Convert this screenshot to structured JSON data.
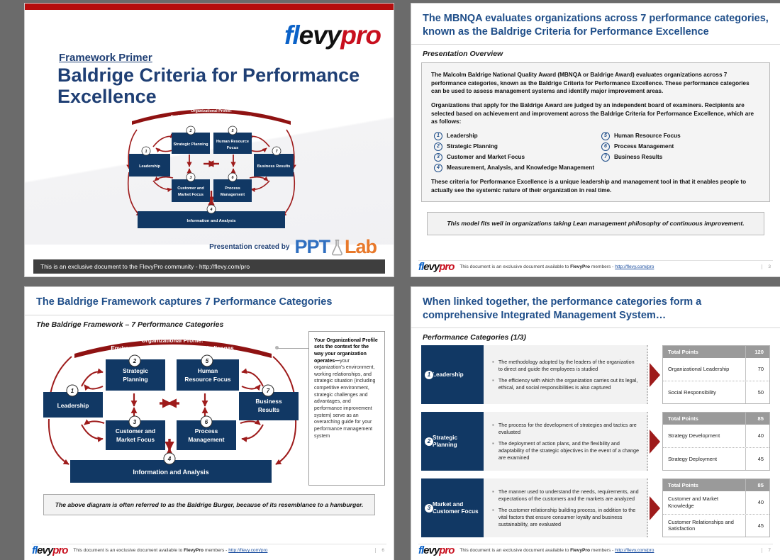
{
  "brand": {
    "logo_part1": "fl",
    "logo_part2": "evy",
    "logo_part3": "pro",
    "accent_blue": "#1f4e89",
    "accent_red": "#b50d0d",
    "dark_navy": "#113864"
  },
  "slide1": {
    "eyebrow": "Framework Primer",
    "title": "Baldrige Criteria for Performance Excellence",
    "created_by_label": "Presentation created by",
    "pptlab_ppt": "PPT",
    "pptlab_lab": "Lab",
    "footer": "This is an exclusive document to the FlevyPro community - http://flevy.com/pro"
  },
  "diagram": {
    "banner_line1": "Organizational Profile:",
    "banner_line2": "Environment, Relationships, and Challenges",
    "boxes": [
      {
        "num": "1",
        "label": "Leadership"
      },
      {
        "num": "2",
        "label": "Strategic Planning"
      },
      {
        "num": "3",
        "label": "Customer and Market Focus"
      },
      {
        "num": "4",
        "label": "Information and Analysis"
      },
      {
        "num": "5",
        "label": "Human Resource Focus"
      },
      {
        "num": "6",
        "label": "Process Management"
      },
      {
        "num": "7",
        "label": "Business Results"
      }
    ]
  },
  "slide2": {
    "title": "The MBNQA evaluates organizations across 7 performance categories, known as the Baldrige Criteria for Performance Excellence",
    "subtitle": "Presentation Overview",
    "para1": "The Malcolm Baldrige National Quality Award (MBNQA or Baldrige Award) evaluates organizations across 7 performance categories, known as the Baldrige Criteria for Performance Excellence. These performance categories can be used to assess management systems and identify major improvement areas.",
    "para2": "Organizations that apply for the Baldrige Award are judged by an independent board of examiners. Recipients are selected based on achievement and improvement across the Baldrige Criteria for Performance Excellence, which are as follows:",
    "criteria": [
      {
        "num": "1",
        "label": "Leadership"
      },
      {
        "num": "5",
        "label": "Human Resource Focus"
      },
      {
        "num": "2",
        "label": "Strategic Planning"
      },
      {
        "num": "6",
        "label": "Process Management"
      },
      {
        "num": "3",
        "label": "Customer and Market Focus"
      },
      {
        "num": "7",
        "label": "Business Results"
      },
      {
        "num": "4",
        "label": "Measurement, Analysis, and Knowledge Management"
      }
    ],
    "closing": "These criteria for Performance Excellence is a unique leadership and management tool in that it enables people to actually see the systemic nature of their organization in real time.",
    "callout": "This model fits well in organizations taking Lean management philosophy of continuous improvement.",
    "page": "3"
  },
  "slide3": {
    "title": "The Baldrige Framework captures 7 Performance Categories",
    "subtitle": "The Baldrige Framework  –  7 Performance Categories",
    "sidebox_bold": "Your Organizational Profile sets the context for the way your organization operates—",
    "sidebox_rest": "your organization's environment, working relationships, and strategic situation (including competitive environment, strategic challenges and advantages, and performance improvement system) serve as an overarching guide for your performance management system",
    "callout": "The above diagram is often referred to as the Baldrige Burger, because of its resemblance to a hamburger.",
    "page": "6"
  },
  "slide4": {
    "title": "When linked together, the performance categories form a comprehensive Integrated Management System…",
    "subtitle": "Performance Categories (1/3)",
    "total_points_label": "Total Points",
    "categories": [
      {
        "num": "1",
        "name": "Leadership",
        "bullets": [
          "The methodology adopted by the leaders of the organization to direct and guide the employees is studied",
          "The efficiency with which the organization carries out its legal, ethical, and social responsibilities is also captured"
        ],
        "total_points": "120",
        "rows": [
          {
            "label": "Organizational Leadership",
            "points": "70"
          },
          {
            "label": "Social Responsibility",
            "points": "50"
          }
        ]
      },
      {
        "num": "2",
        "name": "Strategic Planning",
        "bullets": [
          "The process for the development of strategies and tactics are evaluated",
          "The deployment of action plans, and the flexibility and adaptability of the strategic objectives in the event of a change are examined"
        ],
        "total_points": "85",
        "rows": [
          {
            "label": "Strategy Development",
            "points": "40"
          },
          {
            "label": "Strategy Deployment",
            "points": "45"
          }
        ]
      },
      {
        "num": "3",
        "name": "Market and Customer Focus",
        "bullets": [
          "The manner used to understand the needs, requirements, and expectations of the customers and the markets are analyzed",
          "The customer relationship building process, in addition to the vital factors that ensure consumer loyalty and business sustainability, are evaluated"
        ],
        "total_points": "85",
        "rows": [
          {
            "label": "Customer and Market Knowledge",
            "points": "40"
          },
          {
            "label": "Customer Relationships and Satisfaction",
            "points": "45"
          }
        ]
      }
    ],
    "page": "7"
  },
  "footer_common": {
    "pre": "This document is an exclusive document available to ",
    "brand": "FlevyPro",
    "mid": " members - ",
    "link": "http://flevy.com/pro"
  }
}
